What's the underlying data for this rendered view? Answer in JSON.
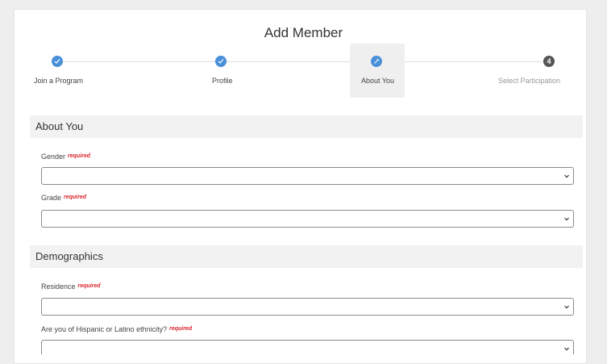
{
  "page": {
    "title": "Add Member"
  },
  "stepper": {
    "steps": [
      {
        "label": "Join a Program",
        "state": "complete",
        "icon": "check-icon"
      },
      {
        "label": "Profile",
        "state": "complete",
        "icon": "check-icon"
      },
      {
        "label": "About You",
        "state": "current",
        "icon": "pencil-icon"
      },
      {
        "label": "Select Participation",
        "state": "upcoming",
        "number": "4"
      }
    ],
    "accent_color": "#4a90d9",
    "upcoming_color": "#555555"
  },
  "sections": {
    "about_you": {
      "title": "About You",
      "gender": {
        "label": "Gender",
        "required": "required",
        "value": ""
      },
      "grade": {
        "label": "Grade",
        "required": "required",
        "value": ""
      }
    },
    "demographics": {
      "title": "Demographics",
      "residence": {
        "label": "Residence",
        "required": "required",
        "value": ""
      },
      "hispanic": {
        "label": "Are you of Hispanic or Latino ethnicity?",
        "required": "required",
        "value": ""
      }
    }
  },
  "colors": {
    "required": "#d9232a",
    "section_bg": "#f2f2f2"
  }
}
